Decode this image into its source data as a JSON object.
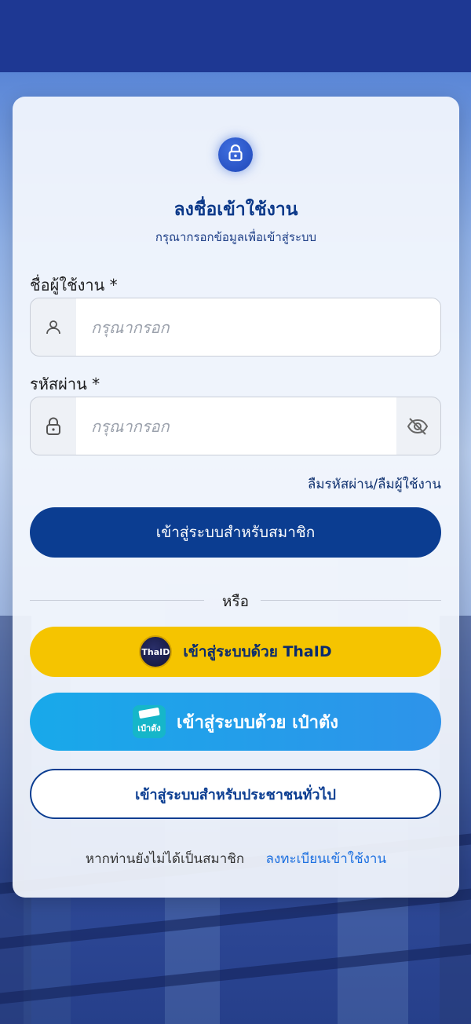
{
  "login": {
    "title": "ลงชื่อเข้าใช้งาน",
    "subtitle": "กรุณากรอกข้อมูลเพื่อเข้าสู่ระบบ",
    "username_label": "ชื่อผู้ใช้งาน *",
    "username_placeholder": "กรุณากรอก",
    "password_label": "รหัสผ่าน *",
    "password_placeholder": "กรุณากรอก",
    "forgot_link": "ลืมรหัสผ่าน/ลืมผู้ใช้งาน",
    "member_button": "เข้าสู่ระบบสำหรับสมาชิก",
    "or_text": "หรือ",
    "thaid_button": "เข้าสู่ระบบด้วย ThaID",
    "thaid_logo_text": "ThaID",
    "paotang_button": "เข้าสู่ระบบด้วย เป๋าตัง",
    "paotang_logo_text": "เป๋าตัง",
    "public_button": "เข้าสู่ระบบสำหรับประชาชนทั่วไป",
    "not_member_text": "หากท่านยังไม่ได้เป็นสมาชิก",
    "register_link": "ลงทะเบียนเข้าใช้งาน"
  },
  "colors": {
    "primary": "#0b3d91",
    "thaid_yellow": "#f5c400",
    "paotang_blue": "#1fa3ea",
    "link_blue": "#1b6fe0"
  },
  "icons": {
    "lock_badge": "lock-icon",
    "username_field": "user-icon",
    "password_field": "lock-icon",
    "password_toggle": "eye-off-icon"
  }
}
